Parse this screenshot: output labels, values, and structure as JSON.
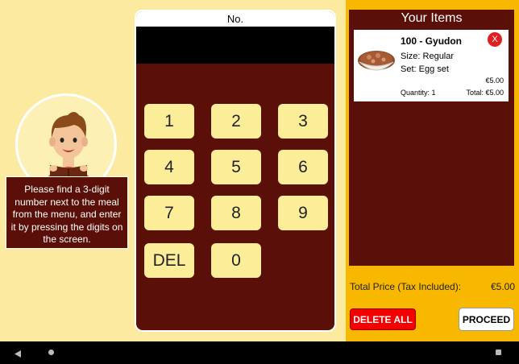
{
  "instruction": "Please find a 3-digit number next to the meal from the menu, and enter it by pressing the digits on the screen.",
  "keypad": {
    "label": "No.",
    "display": "",
    "keys": [
      "1",
      "2",
      "3",
      "4",
      "5",
      "6",
      "7",
      "8",
      "9",
      "DEL",
      "0"
    ]
  },
  "cart": {
    "title": "Your Items",
    "items": [
      {
        "name": "100 - Gyudon",
        "size": "Size: Regular",
        "set": "Set: Egg set",
        "price": "€5.00",
        "quantity": "Quantity: 1",
        "total": "Total: €5.00",
        "remove_label": "X"
      }
    ],
    "total_label": "Total Price (Tax Included):",
    "total_value": "€5.00",
    "delete_all_label": "DELETE ALL",
    "proceed_label": "PROCEED"
  },
  "colors": {
    "background": "#fbeaa0",
    "panel": "#5a1008",
    "accent": "#f8b800",
    "key": "#fcee98",
    "delete": "#f40000"
  }
}
